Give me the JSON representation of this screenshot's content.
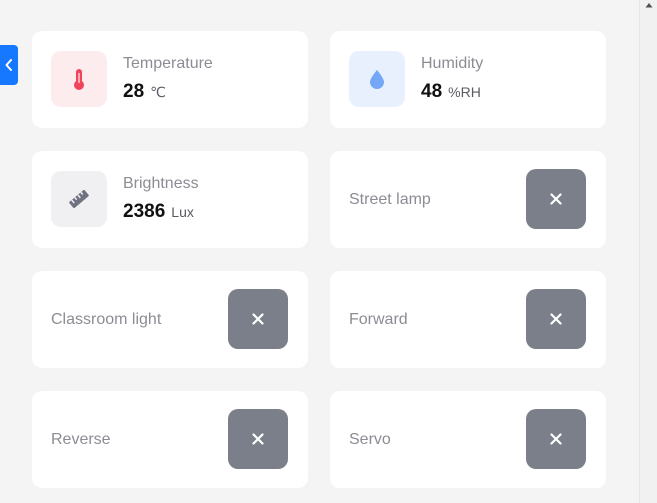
{
  "sensors": {
    "temperature": {
      "label": "Temperature",
      "value": "28",
      "unit": "℃",
      "icon": "thermometer-icon",
      "icon_color": "#f0445c",
      "bg_color": "#fdecee"
    },
    "humidity": {
      "label": "Humidity",
      "value": "48",
      "unit": "%RH",
      "icon": "water-drop-icon",
      "icon_color": "#74a7f5",
      "bg_color": "#e9f0fd"
    },
    "brightness": {
      "label": "Brightness",
      "value": "2386",
      "unit": "Lux",
      "icon": "ruler-icon",
      "icon_color": "#6f7280",
      "bg_color": "#f0f0f2"
    }
  },
  "controls": {
    "street_lamp": {
      "label": "Street lamp",
      "state": "off",
      "icon": "close-icon"
    },
    "classroom_light": {
      "label": "Classroom light",
      "state": "off",
      "icon": "close-icon"
    },
    "forward": {
      "label": "Forward",
      "state": "off",
      "icon": "close-icon"
    },
    "reverse": {
      "label": "Reverse",
      "state": "off",
      "icon": "close-icon"
    },
    "servo": {
      "label": "Servo",
      "state": "off",
      "icon": "close-icon"
    }
  },
  "colors": {
    "accent": "#1677ff",
    "switch_off": "#7b7f89",
    "background": "#f4f4f5",
    "card": "#ffffff"
  },
  "side_toggle": {
    "icon": "chevron-left-icon"
  }
}
